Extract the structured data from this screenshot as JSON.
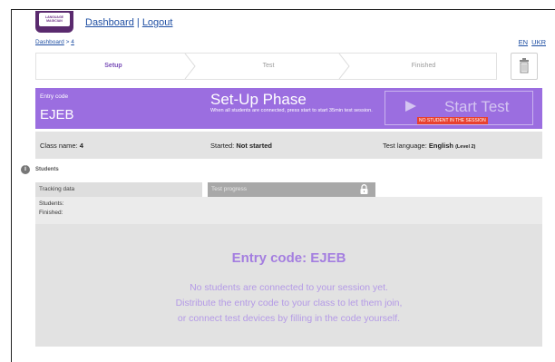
{
  "app": {
    "logo_text": "LANGUAGE MAGICIAN",
    "nav": {
      "dashboard": "Dashboard",
      "separator": "|",
      "logout": "Logout"
    },
    "breadcrumb": {
      "root": "Dashboard",
      "separator": ">",
      "current": "4"
    },
    "languages": [
      "EN",
      "UKR"
    ]
  },
  "steps": [
    {
      "label": "Setup",
      "active": true
    },
    {
      "label": "Test",
      "active": false
    },
    {
      "label": "Finished",
      "active": false
    }
  ],
  "banner": {
    "entry_label": "Entry code",
    "entry_code": "EJEB",
    "phase_title": "Set-Up Phase",
    "phase_description": "When all students are connected, press start to start 35min test session.",
    "start_button": "Start Test",
    "warning": "NO STUDENT IN THE SESSION"
  },
  "info": {
    "class_label": "Class name:",
    "class_value": "4",
    "started_label": "Started:",
    "started_value": "Not started",
    "language_label": "Test language:",
    "language_value": "English",
    "language_level": "(Level 2)"
  },
  "students_section": {
    "title": "Students",
    "tab_tracking": "Tracking data",
    "tab_progress": "Test progress",
    "students_label": "Students:",
    "finished_label": "Finished:"
  },
  "main": {
    "title": "Entry code: EJEB",
    "line1": "No students are connected to your session yet.",
    "line2": "Distribute the entry code to your class to let them join,",
    "line3": "or connect test devices by filling in the code yourself."
  },
  "colors": {
    "accent": "#9b6ee0",
    "warning": "#e8412f",
    "link": "#1f4fa3"
  }
}
